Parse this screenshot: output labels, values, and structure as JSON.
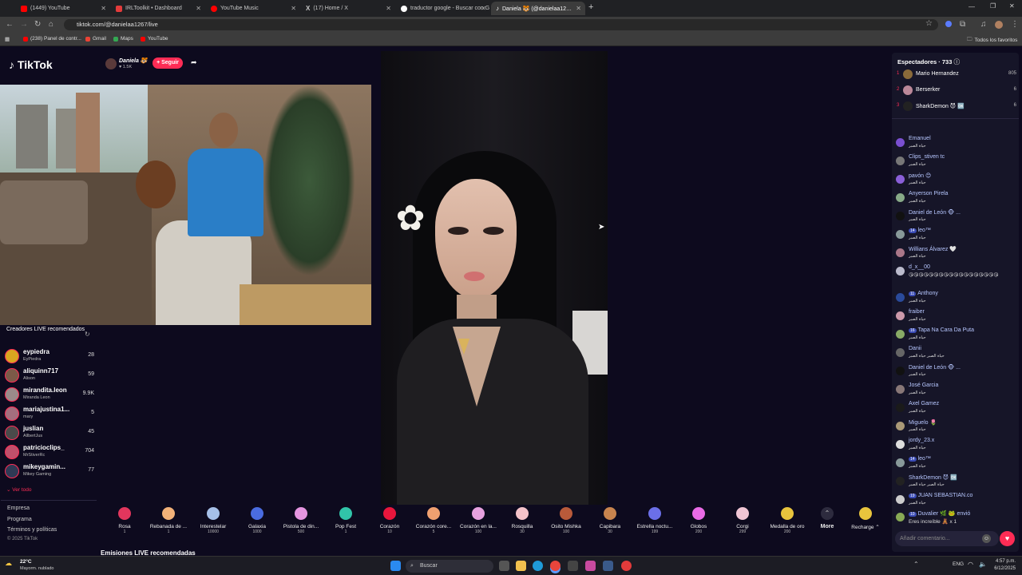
{
  "browser": {
    "tabs": [
      {
        "label": "(1449) YouTube",
        "color": "#ff0000"
      },
      {
        "label": "IRLToolkit • Dashboard",
        "color": "#e33b3b"
      },
      {
        "label": "YouTube Music",
        "color": "#ff0000"
      },
      {
        "label": "(17) Home / X",
        "color": "#ffffff"
      },
      {
        "label": "traductor google - Buscar con G",
        "color": "#4285f4"
      },
      {
        "label": "Daniela 🐯 (@danielaa12…",
        "color": "#ffffff"
      }
    ],
    "url": "tiktok.com/@danielaa1267/live",
    "bookmarks": [
      "(238) Panel de contr...",
      "Gmail",
      "Maps",
      "YouTube"
    ],
    "all_bookmarks": "Todos los favoritos"
  },
  "tiktok": {
    "logo": "TikTok",
    "host_name": "Daniela 🐯",
    "host_followers": "1.5K",
    "follow_label": "+ Seguir",
    "recommended_title": "Creadores LIVE recomendados",
    "creators": [
      {
        "name": "eypiedra",
        "sub": "EyPiedra",
        "count": "28"
      },
      {
        "name": "aliquinn717",
        "sub": "Alison",
        "count": "59"
      },
      {
        "name": "mirandita.leon",
        "sub": "Miranda Leon",
        "count": "9.9K"
      },
      {
        "name": "mariajustina1...",
        "sub": "mary",
        "count": "5"
      },
      {
        "name": "juslian",
        "sub": "AllbertJus",
        "count": "45"
      },
      {
        "name": "patricioclips_",
        "sub": "MrStiverRc",
        "count": "704"
      },
      {
        "name": "mikeygamin...",
        "sub": "Mikey Gaming",
        "count": "77"
      }
    ],
    "see_all": "Ver todo",
    "footer_links": [
      "Empresa",
      "Programa",
      "Términos y políticas",
      "© 2025 TikTok"
    ],
    "recommended_lives": "Emisiones LIVE recomendadas",
    "gifts": [
      {
        "name": "Rosa",
        "price": "1",
        "color": "#e2365d"
      },
      {
        "name": "Rebanada de ...",
        "price": "1",
        "color": "#f2b279"
      },
      {
        "name": "Interestelar",
        "price": "10000",
        "color": "#a6c0e8"
      },
      {
        "name": "Galaxia",
        "price": "1000",
        "color": "#4a6ce0"
      },
      {
        "name": "Pistola de din...",
        "price": "500",
        "color": "#e595e0"
      },
      {
        "name": "Pop Fest",
        "price": "1",
        "color": "#31c4a9"
      },
      {
        "name": "Corazón",
        "price": "10",
        "color": "#e8163c"
      },
      {
        "name": "Corazón core...",
        "price": "5",
        "color": "#f0a070"
      },
      {
        "name": "Corazón en la...",
        "price": "100",
        "color": "#e7a1df"
      },
      {
        "name": "Rosquilla",
        "price": "30",
        "color": "#f4c2c9"
      },
      {
        "name": "Osito Mishka",
        "price": "100",
        "color": "#b85a3a"
      },
      {
        "name": "Capibara",
        "price": "30",
        "color": "#c8844e"
      },
      {
        "name": "Estrella noctu...",
        "price": "199",
        "color": "#6b6fe8"
      },
      {
        "name": "Globos",
        "price": "200",
        "color": "#e96be6"
      },
      {
        "name": "Corgi",
        "price": "299",
        "color": "#f0c5d4"
      },
      {
        "name": "Medalla de oro",
        "price": "200",
        "color": "#e8c43d"
      }
    ],
    "more_label": "More",
    "recharge_label": "Recharge",
    "viewers_title": "Espectadores · 733",
    "top_viewers": [
      {
        "rank": "1",
        "name": "Mario Hernandez",
        "coins": "805"
      },
      {
        "rank": "2",
        "name": "Berserker",
        "coins": "6"
      },
      {
        "rank": "3",
        "name": "SharkDemon 😈 🆗",
        "coins": "6"
      }
    ],
    "chat": [
      {
        "name": "Emanuel",
        "text": "حياة الصبر"
      },
      {
        "name": "Clips_stiven tc",
        "text": "حياة الصبر"
      },
      {
        "name": "pavón 😊",
        "text": "حياة الصبر"
      },
      {
        "name": "Anyerson Pirela",
        "text": "حياة الصبر"
      },
      {
        "name": "Daniel de León 🐵 ...",
        "text": "حياة الصبر"
      },
      {
        "name": "leo™",
        "badge": "14",
        "text": "حياة الصبر"
      },
      {
        "name": "Willians Álvarez 🤍",
        "text": "حياة الصبر"
      },
      {
        "name": "d_x__00",
        "text": "😘😘😘😘😘😘😘😘😘😘😘😘😘😘😘😘😘😘"
      },
      {
        "name": "Anthony",
        "badge": "11",
        "text": "حياة الصبر"
      },
      {
        "name": "fraiber",
        "text": "حياة الصبر"
      },
      {
        "name": "Tapa Na Cara Da Puta",
        "badge": "16",
        "text": "حياة الصبر"
      },
      {
        "name": "Danii",
        "text": "حياة الصبر حياة الصبر"
      },
      {
        "name": "Daniel de León 🐵 ...",
        "text": "حياة الصبر"
      },
      {
        "name": "José Garcia",
        "text": "حياة الصبر"
      },
      {
        "name": "Axel Gamez",
        "text": "حياة الصبر"
      },
      {
        "name": "Miguelo 🌷",
        "text": "حياة الصبر"
      },
      {
        "name": "jordy_23.x",
        "text": "حياة الصبر"
      },
      {
        "name": "leo™",
        "badge": "14",
        "text": "حياة الصبر"
      },
      {
        "name": "SharkDemon 😈 🆗",
        "text": "حياة الصبر حياة الصبر"
      },
      {
        "name": "JUAN SEBASTIAN.co",
        "badge": "19",
        "text": "حياة الصبر"
      },
      {
        "name": "Duvalier 🌿 🐸 envió",
        "badge": "10",
        "text": "Eres increíble 🧸 x 1"
      }
    ],
    "comment_placeholder": "Añadir comentario..."
  },
  "taskbar": {
    "weather_temp": "22°C",
    "weather_desc": "Mayorm. nublado",
    "search_label": "Buscar",
    "lang": "ENG",
    "time": "4:57 p.m.",
    "date": "6/12/2025"
  }
}
